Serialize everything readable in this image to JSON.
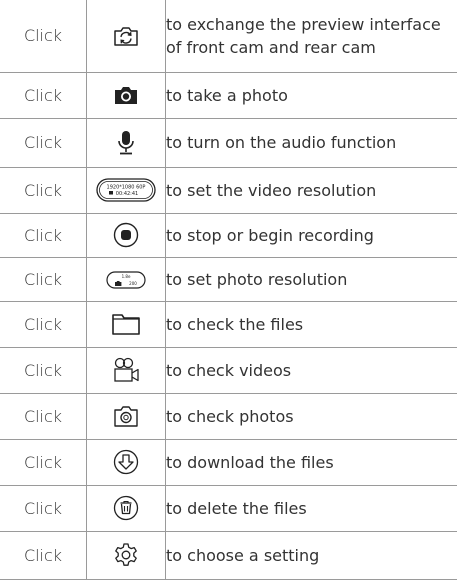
{
  "rows": [
    {
      "action": "Click",
      "icon": "switch-camera-icon",
      "desc": "to exchange the preview interface of front cam and rear cam"
    },
    {
      "action": "Click",
      "icon": "camera-shutter-icon",
      "desc": "to take a photo"
    },
    {
      "action": "Click",
      "icon": "microphone-icon",
      "desc": "to turn on the audio function"
    },
    {
      "action": "Click",
      "icon": "video-resolution-icon",
      "desc": "to set the video resolution",
      "icon_text": [
        "1920*1080 60P",
        "00:42:41"
      ]
    },
    {
      "action": "Click",
      "icon": "record-button-icon",
      "desc": "to stop or begin recording"
    },
    {
      "action": "Click",
      "icon": "photo-resolution-icon",
      "desc": "to set photo resolution",
      "icon_text": [
        "1.8e",
        "200"
      ]
    },
    {
      "action": "Click",
      "icon": "folder-icon",
      "desc": "to check the files"
    },
    {
      "action": "Click",
      "icon": "video-camera-icon",
      "desc": "to check videos"
    },
    {
      "action": "Click",
      "icon": "photo-camera-outline-icon",
      "desc": "to check photos"
    },
    {
      "action": "Click",
      "icon": "download-icon",
      "desc": "to download the files"
    },
    {
      "action": "Click",
      "icon": "trash-icon",
      "desc": "to delete the files"
    },
    {
      "action": "Click",
      "icon": "settings-gear-icon",
      "desc": "to choose a setting"
    }
  ]
}
